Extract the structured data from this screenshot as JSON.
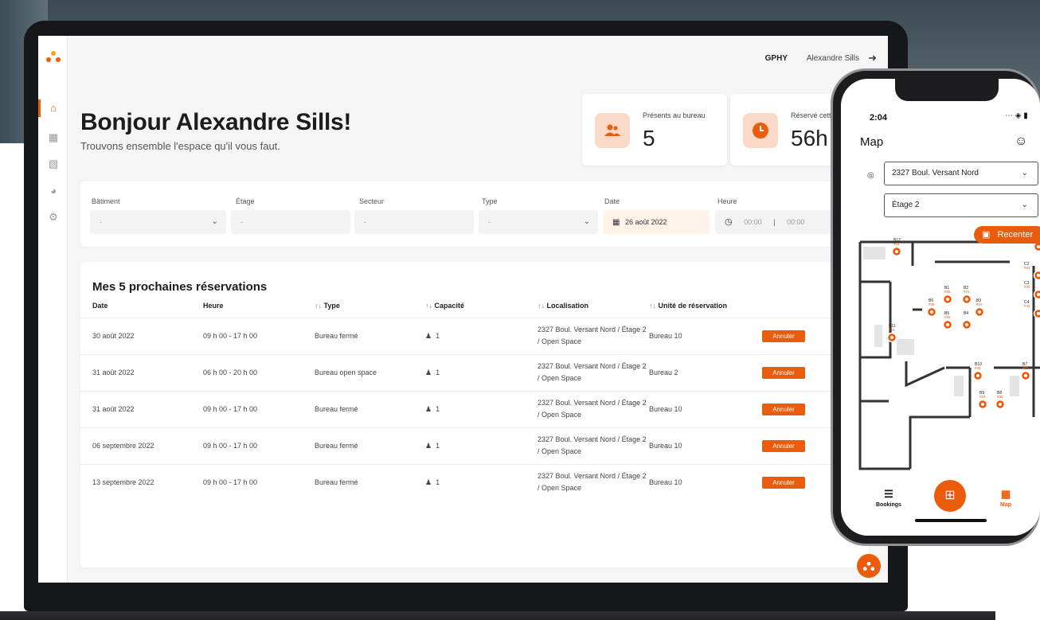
{
  "header": {
    "org_code": "GPHY",
    "user_name": "Alexandre Sills"
  },
  "icons": {
    "brand_logo": "brand-dots-icon",
    "nav": [
      "home-icon",
      "calendar-icon",
      "calendar-check-icon",
      "chart-pie-icon",
      "gear-icon"
    ],
    "logout": "logout-icon"
  },
  "colors": {
    "accent": "#ea5b0c",
    "accent_light": "#fbd9c8"
  },
  "greeting": {
    "title": "Bonjour Alexandre Sills!",
    "subtitle": "Trouvons ensemble l'espace qu'il vous faut."
  },
  "stats": [
    {
      "label": "Présents au bureau",
      "value": "5",
      "icon": "users-icon"
    },
    {
      "label": "Réservé cette",
      "value": "56h",
      "icon": "clock-icon"
    }
  ],
  "filters": {
    "building": {
      "label": "Bâtiment",
      "value": "-"
    },
    "floor": {
      "label": "Étage",
      "value": "-"
    },
    "sector": {
      "label": "Secteur",
      "value": "-"
    },
    "type": {
      "label": "Type",
      "value": "-"
    },
    "date": {
      "label": "Date",
      "value": "26 août 2022"
    },
    "time": {
      "label": "Heure",
      "start": "00:00",
      "separator": "|",
      "end": "00:00"
    }
  },
  "reservations": {
    "title": "Mes 5 prochaines réservations",
    "columns": {
      "date": "Date",
      "time": "Heure",
      "type": "Type",
      "capacity": "Capacité",
      "location": "Localisation",
      "unit": "Unité de réservation"
    },
    "sort_glyph": "↑↓",
    "cancel_label": "Annuler",
    "rows": [
      {
        "date": "30 août 2022",
        "time": "09 h 00 - 17 h 00",
        "type": "Bureau fermé",
        "capacity": "1",
        "location": "2327 Boul. Versant Nord / Étage 2 / Open Space",
        "unit": "Bureau 10"
      },
      {
        "date": "31 août 2022",
        "time": "06 h 00 - 20 h 00",
        "type": "Bureau open space",
        "capacity": "1",
        "location": "2327 Boul. Versant Nord / Étage 2 / Open Space",
        "unit": "Bureau 2"
      },
      {
        "date": "31 août 2022",
        "time": "09 h 00 - 17 h 00",
        "type": "Bureau fermé",
        "capacity": "1",
        "location": "2327 Boul. Versant Nord / Étage 2 / Open Space",
        "unit": "Bureau 10"
      },
      {
        "date": "06 septembre 2022",
        "time": "09 h 00 - 17 h 00",
        "type": "Bureau fermé",
        "capacity": "1",
        "location": "2327 Boul. Versant Nord / Étage 2 / Open Space",
        "unit": "Bureau 10"
      },
      {
        "date": "13 septembre 2022",
        "time": "09 h 00 - 17 h 00",
        "type": "Bureau fermé",
        "capacity": "1",
        "location": "2327 Boul. Versant Nord / Étage 2 / Open Space",
        "unit": "Bureau 10"
      }
    ]
  },
  "phone": {
    "time": "2:04",
    "title": "Map",
    "address_select": "2327 Boul. Versant Nord",
    "floor_select": "Étage 2",
    "recenter_label": "Recenter",
    "tabs": {
      "bookings": "Bookings",
      "map": "Map"
    },
    "desks": [
      {
        "id": "B12",
        "num": "#64"
      },
      {
        "id": "B1",
        "num": "#55"
      },
      {
        "id": "B2",
        "num": "#21"
      },
      {
        "id": "B6",
        "num": "#39"
      },
      {
        "id": "B3",
        "num": "#19"
      },
      {
        "id": "B5",
        "num": "#18"
      },
      {
        "id": "B4",
        "num": ""
      },
      {
        "id": "B11",
        "num": "#16"
      },
      {
        "id": "B10",
        "num": "#36"
      },
      {
        "id": "B9",
        "num": "#37"
      },
      {
        "id": "B8",
        "num": "#38"
      },
      {
        "id": "B7",
        "num": "#59"
      },
      {
        "id": "C2",
        "num": "#61"
      },
      {
        "id": "C3",
        "num": "#32"
      },
      {
        "id": "C4",
        "num": "#42"
      },
      {
        "id": "",
        "num": "#40"
      }
    ]
  }
}
